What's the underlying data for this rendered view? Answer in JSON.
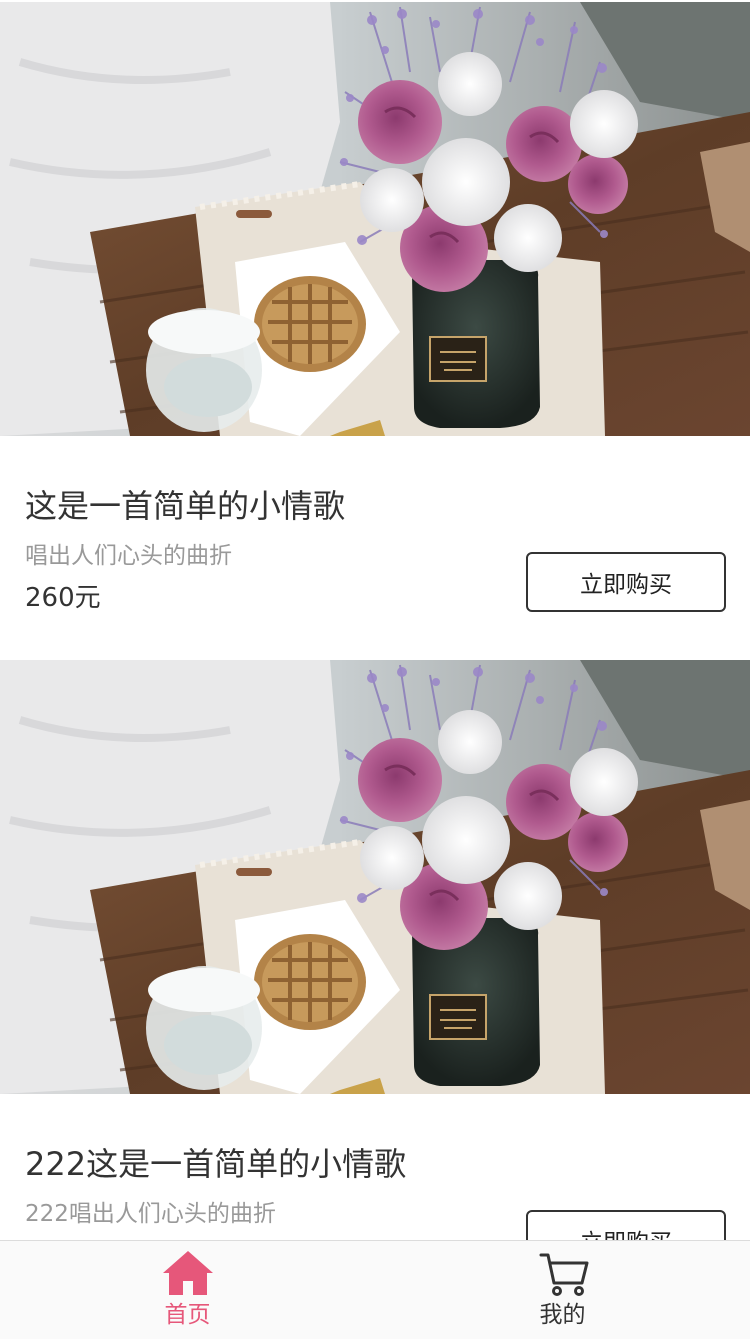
{
  "products": [
    {
      "title": "这是一首简单的小情歌",
      "subtitle": "唱出人们心头的曲折",
      "price": "260元",
      "buy_label": "立即购买"
    },
    {
      "title": "222这是一首简单的小情歌",
      "subtitle": "222唱出人们心头的曲折",
      "price": "",
      "buy_label": "立即购买"
    }
  ],
  "tabbar": {
    "tabs": [
      {
        "label": "首页",
        "icon": "home-icon",
        "active": true
      },
      {
        "label": "我的",
        "icon": "cart-icon",
        "active": false
      }
    ],
    "active_color": "#e6577a",
    "inactive_color": "#333333"
  }
}
